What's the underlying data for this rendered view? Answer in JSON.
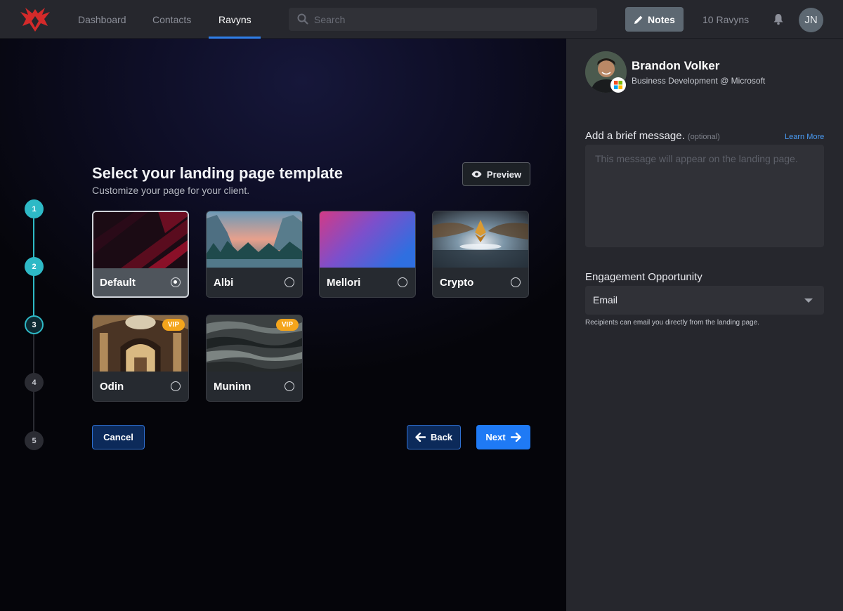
{
  "nav": {
    "links": [
      {
        "label": "Dashboard",
        "active": false
      },
      {
        "label": "Contacts",
        "active": false
      },
      {
        "label": "Ravyns",
        "active": true
      }
    ],
    "search_placeholder": "Search",
    "notes_label": "Notes",
    "ravyns_count": "10 Ravyns",
    "user_initials": "JN"
  },
  "wizard": {
    "steps": [
      {
        "number": "1",
        "state": "done"
      },
      {
        "number": "2",
        "state": "done"
      },
      {
        "number": "3",
        "state": "current"
      },
      {
        "number": "4",
        "state": "todo"
      },
      {
        "number": "5",
        "state": "todo"
      }
    ],
    "title": "Select your landing page template",
    "subtitle": "Customize your page for your client.",
    "preview_label": "Preview",
    "templates": [
      {
        "name": "Default",
        "selected": true,
        "vip": false
      },
      {
        "name": "Albi",
        "selected": false,
        "vip": false
      },
      {
        "name": "Mellori",
        "selected": false,
        "vip": false
      },
      {
        "name": "Crypto",
        "selected": false,
        "vip": false
      },
      {
        "name": "Odin",
        "selected": false,
        "vip": true
      },
      {
        "name": "Muninn",
        "selected": false,
        "vip": true
      }
    ],
    "vip_label": "VIP",
    "cancel_label": "Cancel",
    "back_label": "Back",
    "next_label": "Next"
  },
  "panel": {
    "name": "Brandon Volker",
    "role": "Business Development @ Microsoft",
    "message_label": "Add a brief message.",
    "message_optional": "(optional)",
    "learn_more": "Learn More",
    "message_placeholder": "This message will appear on the landing page.",
    "engagement_label": "Engagement Opportunity",
    "engagement_value": "Email",
    "engagement_help": "Recipients can email you directly from the landing page."
  },
  "colors": {
    "accent_blue": "#1f7af5",
    "stepper_teal": "#2eb9c6",
    "vip_orange": "#f4a51c",
    "panel_bg": "#26272d"
  }
}
